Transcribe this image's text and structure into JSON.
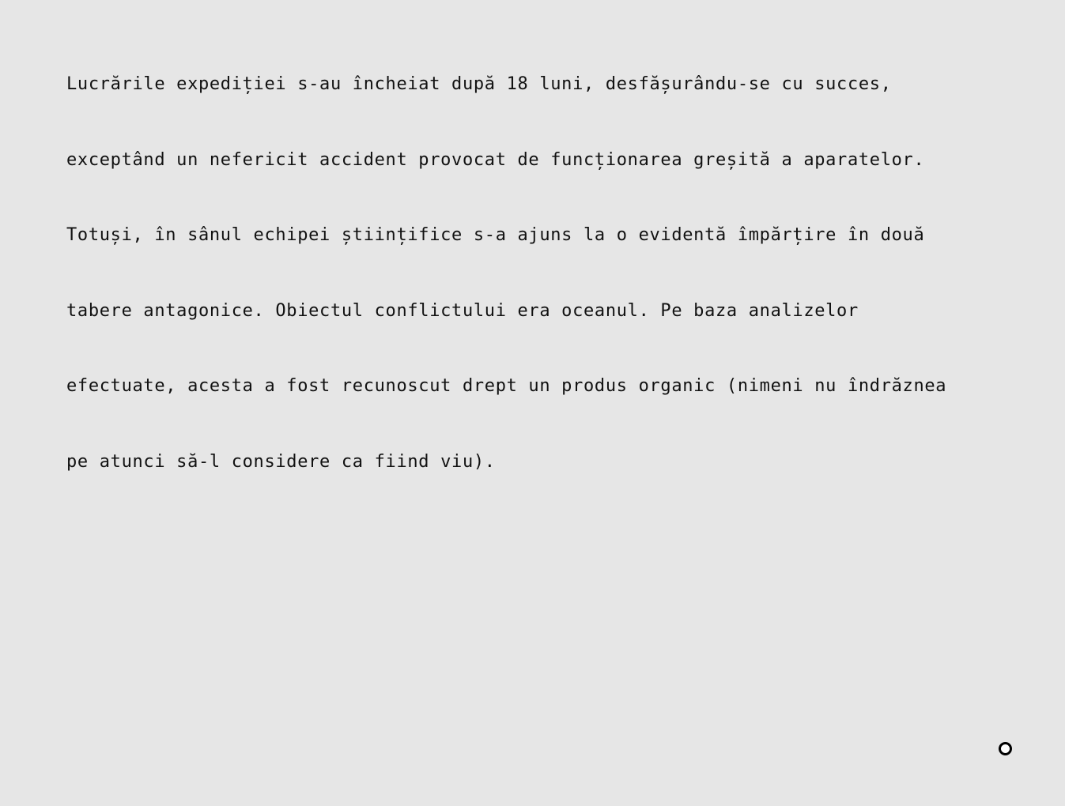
{
  "document": {
    "lines": [
      "Lucrările expediției s-au încheiat după 18 luni, desfășurându-se cu succes,",
      "exceptând un nefericit accident provocat de funcționarea greșită a aparatelor.",
      "Totuși, în sânul echipei științifice s-a ajuns la o evidentă împărțire în două",
      "tabere antagonice. Obiectul conflictului era oceanul. Pe baza analizelor",
      "efectuate, acesta a fost recunoscut drept un produs organic (nimeni nu îndrăznea",
      "pe atunci să-l considere ca fiind viu)."
    ]
  },
  "indicator": {
    "icon": "ring-icon",
    "color": "#000000"
  }
}
